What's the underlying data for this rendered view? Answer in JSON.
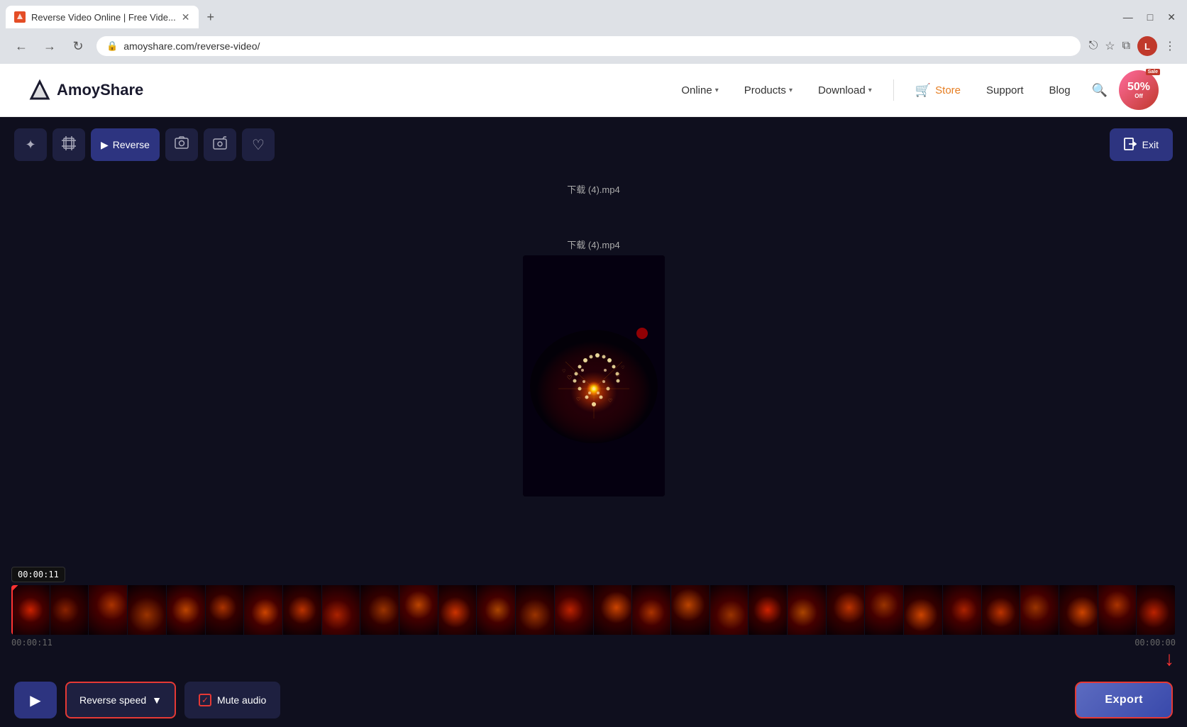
{
  "browser": {
    "tab_title": "Reverse Video Online | Free Vide...",
    "new_tab_label": "+",
    "address": "amoyshare.com/reverse-video/",
    "minimize": "—",
    "maximize": "□",
    "close": "✕",
    "window_controls_left": "⌄",
    "back": "←",
    "forward": "→",
    "refresh": "↻",
    "more_options": "⋮",
    "user_initial": "L",
    "share_icon": "⎋",
    "bookmark_icon": "☆",
    "extensions_icon": "⧉"
  },
  "site_header": {
    "logo_text": "AmoyShare",
    "nav_items": [
      {
        "label": "Online",
        "has_dropdown": true
      },
      {
        "label": "Products",
        "has_dropdown": true
      },
      {
        "label": "Download",
        "has_dropdown": true
      }
    ],
    "store_label": "Store",
    "support_label": "Support",
    "blog_label": "Blog",
    "sale_pct": "50%",
    "sale_tag": "Sale",
    "sale_off": "Off"
  },
  "toolbar": {
    "tools": [
      {
        "name": "magic-tool",
        "icon": "✦",
        "active": false
      },
      {
        "name": "crop-tool",
        "icon": "⊞",
        "active": false
      },
      {
        "name": "reverse-tool",
        "icon": "▶",
        "label": "Reverse",
        "active": true
      },
      {
        "name": "screenshot-tool",
        "icon": "⬚",
        "active": false
      },
      {
        "name": "camera-tool",
        "icon": "⬜",
        "active": false
      },
      {
        "name": "heart-tool",
        "icon": "♡",
        "active": false
      }
    ],
    "exit_label": "Exit"
  },
  "video_preview": {
    "filename": "下载 (4).mp4"
  },
  "timeline": {
    "start_time": "00:00:11",
    "end_time": "00:00:00",
    "current_time": "00:00:11",
    "frame_count": 30
  },
  "bottom_controls": {
    "play_icon": "▶",
    "reverse_speed_label": "Reverse speed",
    "reverse_speed_arrow": "▼",
    "mute_audio_label": "Mute audio",
    "export_label": "Export"
  },
  "colors": {
    "editor_bg": "#0f0f1e",
    "toolbar_btn_bg": "#1e2040",
    "toolbar_btn_active": "#2d3480",
    "export_border": "#e53935",
    "cursor_color": "#ff3333"
  }
}
